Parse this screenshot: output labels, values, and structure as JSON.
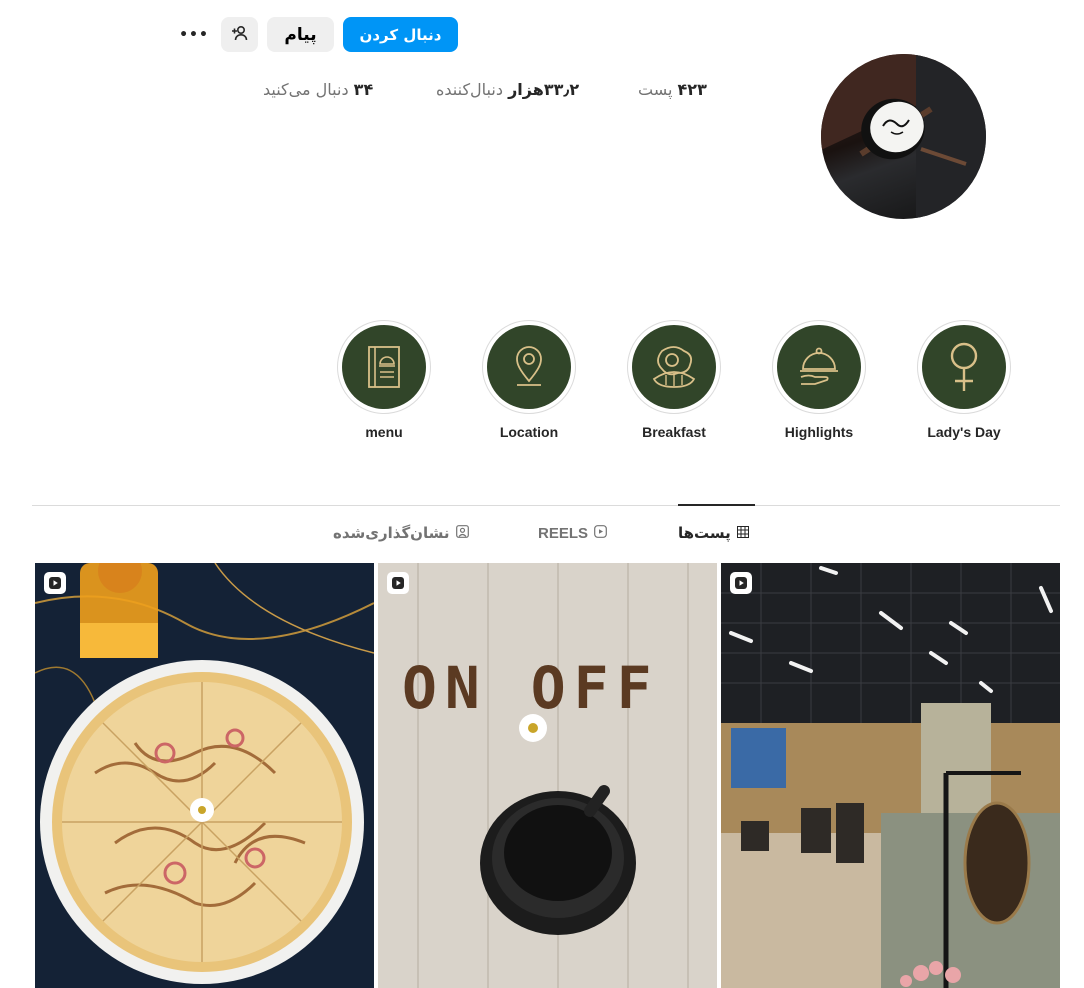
{
  "profile": {
    "follow_label": "دنبال کردن",
    "message_label": "پیام",
    "more_glyph": "•••",
    "stats": {
      "posts_value": "۴۲۳",
      "posts_label": "پست",
      "followers_value": "۳۳٫۲هزار",
      "followers_label": "دنبال‌کننده",
      "following_value": "۳۴",
      "following_label": "دنبال می‌کنید"
    }
  },
  "highlights": [
    {
      "label": "Lady's Day",
      "icon": "female-symbol-icon"
    },
    {
      "label": "Highlights",
      "icon": "serving-cloche-icon"
    },
    {
      "label": "Breakfast",
      "icon": "fried-egg-croissant-icon"
    },
    {
      "label": "Location",
      "icon": "location-pin-icon"
    },
    {
      "label": "menu",
      "icon": "menu-book-icon"
    }
  ],
  "tabs": {
    "posts_label": "پست‌ها",
    "reels_label": "REELS",
    "tagged_label": "نشان‌گذاری‌شده",
    "active": "posts"
  },
  "posts": [
    {
      "kind": "reel",
      "subject": "pizza"
    },
    {
      "kind": "reel",
      "subject": "coffee-on-off",
      "art_text": "ON OFF"
    },
    {
      "kind": "reel",
      "subject": "cafe-interior"
    }
  ],
  "colors": {
    "accent": "#0095f6",
    "highlight_fill": "#314529",
    "highlight_icon": "#d9c089"
  }
}
